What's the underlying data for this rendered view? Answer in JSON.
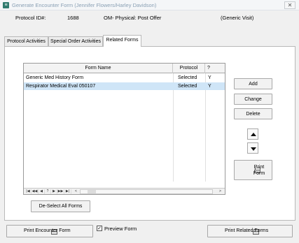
{
  "window": {
    "title": "Generate Encounter Form (Jennifer Flowers/Harley Davidson)",
    "icon_name": "app-icon",
    "close_label": "✕"
  },
  "header": {
    "protocol_label": "Protocol ID#:",
    "protocol_id": "1688",
    "protocol_name": "OM- Physical: Post Offer",
    "visit_type": "(Generic Visit)"
  },
  "tabs": [
    {
      "label": "Protocol Activities",
      "u": "A"
    },
    {
      "label": "Special Order Activities",
      "u": "O"
    },
    {
      "label": "Related Forms",
      "u": "F"
    }
  ],
  "grid": {
    "columns": [
      "Form Name",
      "Protocol",
      "?"
    ],
    "rows": [
      {
        "name": "Generic Med History Form",
        "protocol": "Selected",
        "flag": "Y"
      },
      {
        "name": "Respirator Medical Eval 050107",
        "protocol": "Selected",
        "flag": "Y"
      }
    ],
    "nav": [
      "|◀",
      "◀◀",
      "◀",
      "?",
      "▶",
      "▶▶",
      "▶|"
    ],
    "scroll_left": "<",
    "scroll_right": ">"
  },
  "buttons": {
    "add": "Add",
    "change": "Change",
    "delete": "Delete",
    "print_form_1": "Print",
    "print_form_2": "Form",
    "deselect_all": "De-Select All Forms",
    "print_encounter": "Print Encounter Form",
    "preview_form": "Preview Form",
    "print_related": "Print Related Forms"
  },
  "preview_checked": true
}
